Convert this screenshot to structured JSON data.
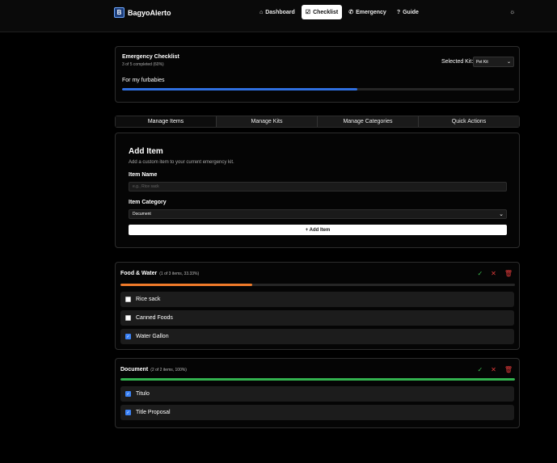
{
  "app": {
    "logo_letter": "B",
    "name": "BagyoAlerto"
  },
  "nav": [
    {
      "label": "Dashboard",
      "icon": "⌂",
      "active": false
    },
    {
      "label": "Checklist",
      "icon": "☑",
      "active": true
    },
    {
      "label": "Emergency",
      "icon": "✆",
      "active": false
    },
    {
      "label": "Guide",
      "icon": "?",
      "active": false
    }
  ],
  "theme_icon": "☼",
  "summary": {
    "title": "Emergency Checklist",
    "subtitle": "3 of 5 completed (60%)",
    "kit_label": "Selected Kit:",
    "kit_value": "Pet Kit",
    "description": "For my furbabies",
    "progress": 0.6,
    "progress_color": "#2f6fe0"
  },
  "tabs": [
    "Manage Items",
    "Manage Kits",
    "Manage Categories",
    "Quick Actions"
  ],
  "add_item": {
    "title": "Add Item",
    "description": "Add a custom item to your current emergency kit.",
    "name_label": "Item Name",
    "name_placeholder": "e.g., Rice sack",
    "category_label": "Item Category",
    "category_value": "Document",
    "button_label": "+ Add Item"
  },
  "categories": [
    {
      "name": "Food & Water",
      "meta": "(1 of 3 items, 33.33%)",
      "progress": 0.3333,
      "color": "#f07a2a",
      "items": [
        {
          "label": "Rice sack",
          "checked": false
        },
        {
          "label": "Canned Foods",
          "checked": false
        },
        {
          "label": "Water Gallon",
          "checked": true
        }
      ]
    },
    {
      "name": "Document",
      "meta": "(2 of 2 items, 100%)",
      "progress": 1.0,
      "color": "#33b24f",
      "items": [
        {
          "label": "Titulo",
          "checked": true
        },
        {
          "label": "Title Proposal",
          "checked": true
        }
      ]
    }
  ],
  "icons": {
    "check": "✓",
    "cross": "✕",
    "trash": "🗑",
    "chevron": "⌄",
    "tick": "✓"
  }
}
